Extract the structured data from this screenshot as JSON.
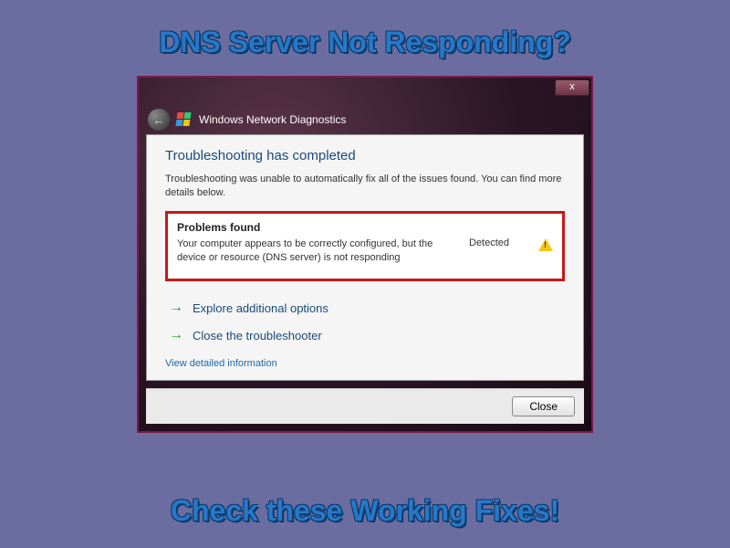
{
  "banner": {
    "top": "DNS Server Not Responding?",
    "bottom": "Check these Working Fixes!"
  },
  "window": {
    "title": "Windows Network Diagnostics",
    "close_x": "x"
  },
  "content": {
    "heading": "Troubleshooting has completed",
    "subtext": "Troubleshooting was unable to automatically fix all of the issues found. You can find more details below.",
    "problems_title": "Problems found",
    "problem_desc": "Your computer appears to be correctly configured, but the device or resource (DNS server) is not responding",
    "problem_status": "Detected",
    "option_explore": "Explore additional options",
    "option_close": "Close the troubleshooter",
    "detail_link": "View detailed information",
    "close_button": "Close"
  }
}
